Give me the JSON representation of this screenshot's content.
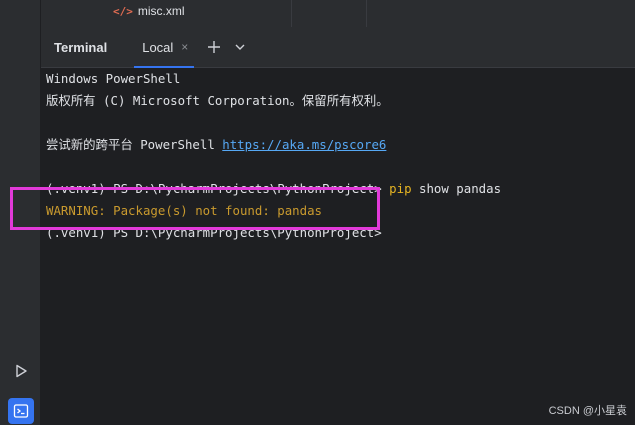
{
  "file_tree": {
    "item_label": "misc.xml",
    "icon": "xml-file-icon"
  },
  "tool_window": {
    "title": "Terminal",
    "tab_label": "Local",
    "close_glyph": "×",
    "add_glyph": "+",
    "menu_icon": "chevron-down-icon"
  },
  "terminal": {
    "lines": [
      "Windows PowerShell",
      "版权所有 (C) Microsoft Corporation。保留所有权利。",
      "",
      "尝试新的跨平台 PowerShell ",
      "",
      "(.venv1) PS D:\\PycharmProjects\\PythonProject> ",
      "WARNING: Package(s) not found: pandas",
      "(.venv1) PS D:\\PycharmProjects\\PythonProject>"
    ],
    "link": "https://aka.ms/pscore6",
    "command_name": "pip",
    "command_args": " show pandas"
  },
  "sidebar": {
    "run_icon": "run-icon",
    "terminal_icon": "terminal-icon"
  },
  "watermark": "CSDN @小星袁",
  "colors": {
    "accent": "#3574f0",
    "highlight": "#e23ad9",
    "warning": "#c99a2e",
    "command": "#e6b422",
    "link": "#56a8f5"
  }
}
